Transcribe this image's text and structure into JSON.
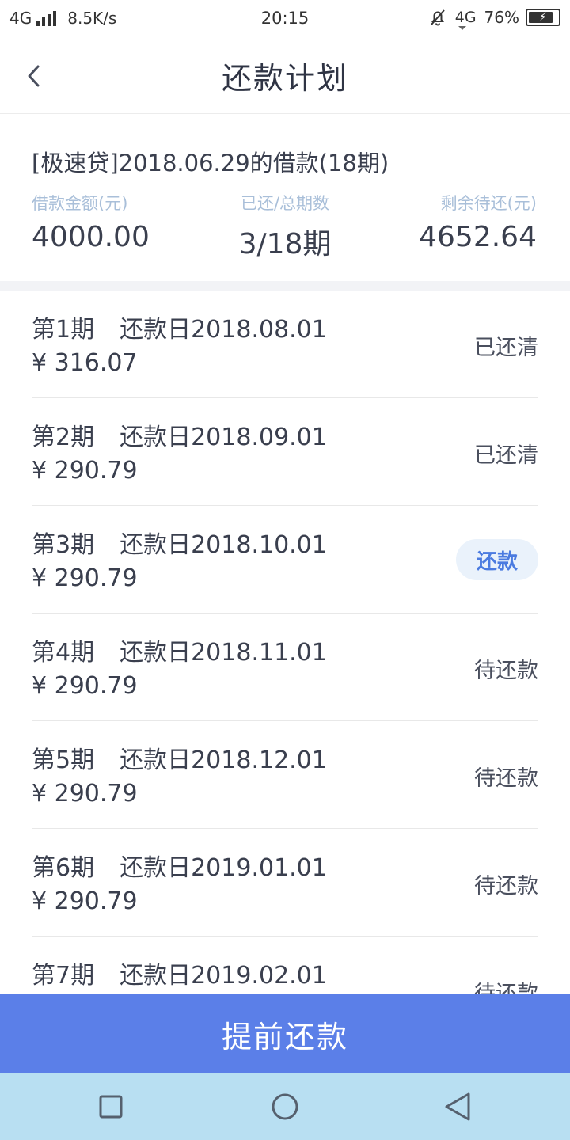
{
  "status_bar": {
    "network": "4G",
    "speed": "8.5K/s",
    "time": "20:15",
    "network2": "4G",
    "battery": "76%",
    "icons": [
      "signal-icon",
      "bell-off-icon",
      "battery-charging-icon"
    ]
  },
  "header": {
    "title": "还款计划",
    "back_icon": "chevron-left-icon"
  },
  "loan": {
    "title": "[极速贷]2018.06.29的借款(18期)",
    "amount_label": "借款金额(元)",
    "amount_value": "4000.00",
    "progress_label": "已还/总期数",
    "progress_value": "3/18期",
    "remaining_label": "剩余待还(元)",
    "remaining_value": "4652.64"
  },
  "installments": [
    {
      "period": "第1期",
      "due": "还款日2018.08.01",
      "amount": "¥ 316.07",
      "status": "已还清",
      "is_button": false
    },
    {
      "period": "第2期",
      "due": "还款日2018.09.01",
      "amount": "¥ 290.79",
      "status": "已还清",
      "is_button": false
    },
    {
      "period": "第3期",
      "due": "还款日2018.10.01",
      "amount": "¥ 290.79",
      "status": "还款",
      "is_button": true
    },
    {
      "period": "第4期",
      "due": "还款日2018.11.01",
      "amount": "¥ 290.79",
      "status": "待还款",
      "is_button": false
    },
    {
      "period": "第5期",
      "due": "还款日2018.12.01",
      "amount": "¥ 290.79",
      "status": "待还款",
      "is_button": false
    },
    {
      "period": "第6期",
      "due": "还款日2019.01.01",
      "amount": "¥ 290.79",
      "status": "待还款",
      "is_button": false
    },
    {
      "period": "第7期",
      "due": "还款日2019.02.01",
      "amount": "",
      "status": "待还款",
      "is_button": false
    }
  ],
  "cta": {
    "label": "提前还款"
  },
  "colors": {
    "accent": "#5b7fe8",
    "pay_button_bg": "#eaf2fb",
    "pay_button_text": "#4b7be0",
    "label_muted": "#a9bfd9",
    "navbar_bg": "#b8dff2"
  },
  "navbar": {
    "icons": [
      "recent-apps-icon",
      "home-icon",
      "back-triangle-icon"
    ]
  }
}
